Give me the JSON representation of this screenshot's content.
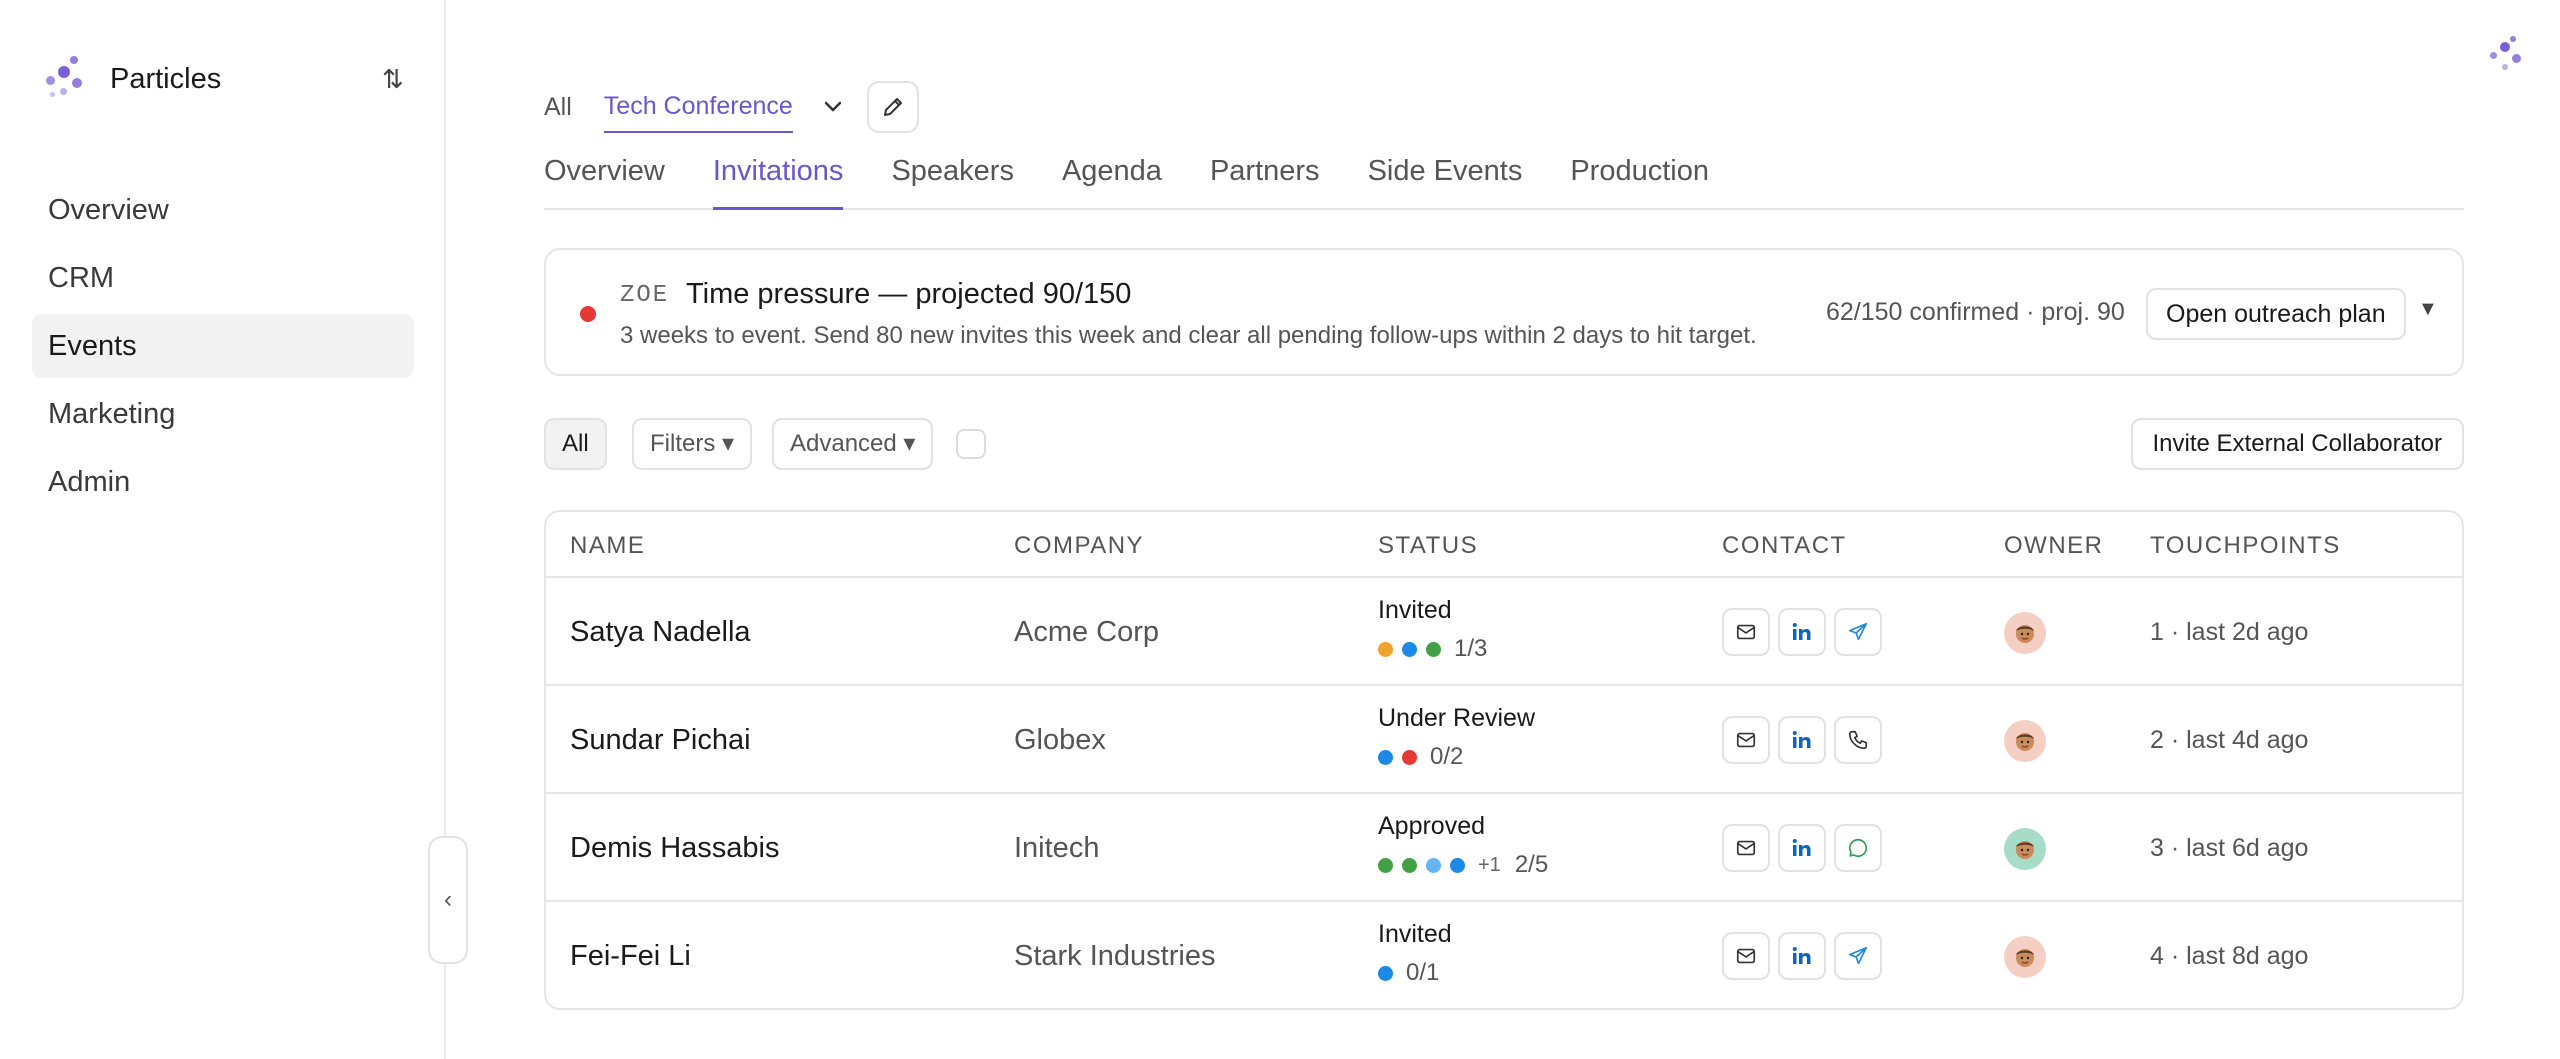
{
  "app": {
    "name": "Particles"
  },
  "sidebar": {
    "items": [
      {
        "label": "Overview",
        "active": false
      },
      {
        "label": "CRM",
        "active": false
      },
      {
        "label": "Events",
        "active": true
      },
      {
        "label": "Marketing",
        "active": false
      },
      {
        "label": "Admin",
        "active": false
      }
    ]
  },
  "context": {
    "all_label": "All",
    "event_label": "Tech Conference"
  },
  "tabs": [
    {
      "label": "Overview",
      "active": false
    },
    {
      "label": "Invitations",
      "active": true
    },
    {
      "label": "Speakers",
      "active": false
    },
    {
      "label": "Agenda",
      "active": false
    },
    {
      "label": "Partners",
      "active": false
    },
    {
      "label": "Side Events",
      "active": false
    },
    {
      "label": "Production",
      "active": false
    }
  ],
  "alert": {
    "source": "ZOE",
    "title": "Time pressure — projected 90/150",
    "description": "3 weeks to event. Send 80 new invites this week and clear all pending follow-ups within 2 days to hit target.",
    "count": "62/150 confirmed · proj. 90",
    "action_label": "Open outreach plan",
    "dot_color": "#e53935"
  },
  "filters": {
    "all_label": "All",
    "filters_label": "Filters ▾",
    "advanced_label": "Advanced ▾",
    "invite_label": "Invite External Collaborator"
  },
  "table": {
    "headers": {
      "name": "NAME",
      "company": "COMPANY",
      "status": "STATUS",
      "contact": "CONTACT",
      "owner": "OWNER",
      "touchpoints": "TOUCHPOINTS"
    },
    "rows": [
      {
        "name": "Satya Nadella",
        "company": "Acme Corp",
        "status": "Invited",
        "dots": [
          "#f0a330",
          "#1e88e5",
          "#43a047"
        ],
        "extra": "",
        "progress": "1/3",
        "contact": [
          "mail-icon",
          "linkedin-icon",
          "send-icon"
        ],
        "owner_bg": "#f5cfc4",
        "touchpoints": "1 · last 2d ago"
      },
      {
        "name": "Sundar Pichai",
        "company": "Globex",
        "status": "Under Review",
        "dots": [
          "#1e88e5",
          "#e53935"
        ],
        "extra": "",
        "progress": "0/2",
        "contact": [
          "mail-icon",
          "linkedin-icon",
          "phone-icon"
        ],
        "owner_bg": "#f5cfc4",
        "touchpoints": "2 · last 4d ago"
      },
      {
        "name": "Demis Hassabis",
        "company": "Initech",
        "status": "Approved",
        "dots": [
          "#43a047",
          "#43a047",
          "#64b5f6",
          "#1e88e5"
        ],
        "extra": "+1",
        "progress": "2/5",
        "contact": [
          "mail-icon",
          "linkedin-icon",
          "whatsapp-icon"
        ],
        "owner_bg": "#a8dcc8",
        "touchpoints": "3 · last 6d ago"
      },
      {
        "name": "Fei-Fei Li",
        "company": "Stark Industries",
        "status": "Invited",
        "dots": [
          "#1e88e5"
        ],
        "extra": "",
        "progress": "0/1",
        "contact": [
          "mail-icon",
          "linkedin-icon",
          "send-icon"
        ],
        "owner_bg": "#f5cfc4",
        "touchpoints": "4 · last 8d ago"
      }
    ]
  }
}
